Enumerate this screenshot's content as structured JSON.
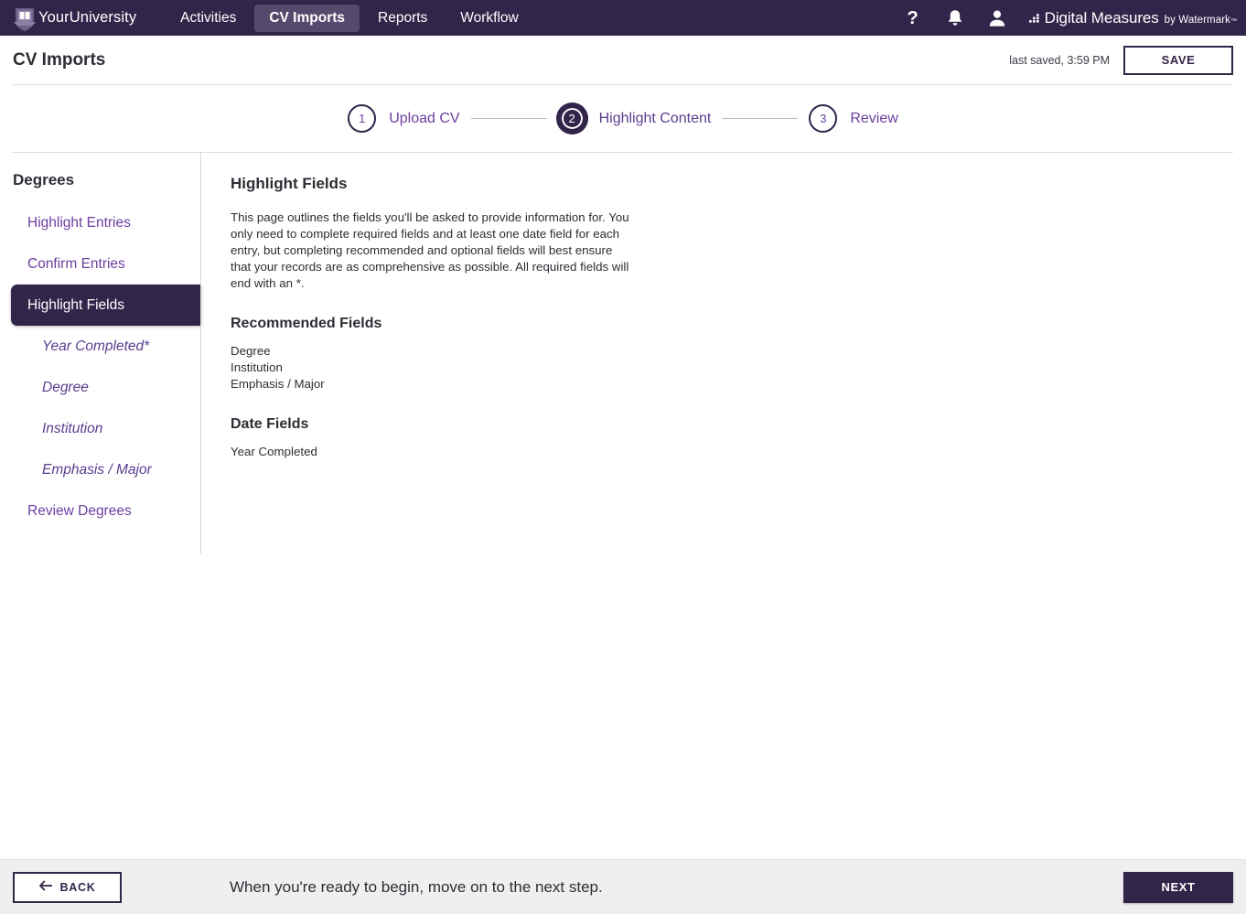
{
  "topbar": {
    "university_name": "YourUniversity",
    "logo_icon": "university-crest-book-icon",
    "nav": [
      {
        "label": "Activities",
        "active": false
      },
      {
        "label": "CV Imports",
        "active": true
      },
      {
        "label": "Reports",
        "active": false
      },
      {
        "label": "Workflow",
        "active": false
      }
    ],
    "icons": [
      {
        "name": "help-icon",
        "glyph": "?"
      },
      {
        "name": "notifications-bell-icon",
        "glyph": "bell"
      },
      {
        "name": "user-account-icon",
        "glyph": "person"
      }
    ],
    "product_logo": {
      "name": "Digital Measures",
      "by": "by Watermark",
      "tm": "™"
    },
    "colors": {
      "bar_background": "#32254a",
      "active_pill": "#554a6c"
    }
  },
  "titlebar": {
    "title": "CV Imports",
    "last_saved": "last saved, 3:59 PM",
    "save_label": "SAVE"
  },
  "stepper": {
    "steps": [
      {
        "number": "1",
        "label": "Upload CV",
        "active": false
      },
      {
        "number": "2",
        "label": "Highlight Content",
        "active": true
      },
      {
        "number": "3",
        "label": "Review",
        "active": false
      }
    ]
  },
  "sidebar": {
    "heading": "Degrees",
    "items": [
      {
        "label": "Highlight Entries",
        "type": "item",
        "active": false
      },
      {
        "label": "Confirm Entries",
        "type": "item",
        "active": false
      },
      {
        "label": "Highlight Fields",
        "type": "item",
        "active": true
      },
      {
        "label": "Year Completed*",
        "type": "sub",
        "active": false
      },
      {
        "label": "Degree",
        "type": "sub",
        "active": false
      },
      {
        "label": "Institution",
        "type": "sub",
        "active": false
      },
      {
        "label": "Emphasis / Major",
        "type": "sub",
        "active": false
      },
      {
        "label": "Review Degrees",
        "type": "item",
        "active": false
      }
    ]
  },
  "main": {
    "heading": "Highlight Fields",
    "intro": "This page outlines the fields you'll be asked to provide information for. You only need to complete required fields and at least one date field for each entry, but completing recommended and optional fields will best ensure that your records are as comprehensive as possible. All required fields will end with an *.",
    "recommended_heading": "Recommended Fields",
    "recommended_fields": [
      "Degree",
      "Institution",
      "Emphasis / Major"
    ],
    "date_heading": "Date Fields",
    "date_fields": [
      "Year Completed"
    ]
  },
  "footer": {
    "back_label": "BACK",
    "back_icon": "arrow-left-icon",
    "message": "When you're ready to begin, move on to the next step.",
    "next_label": "NEXT"
  }
}
